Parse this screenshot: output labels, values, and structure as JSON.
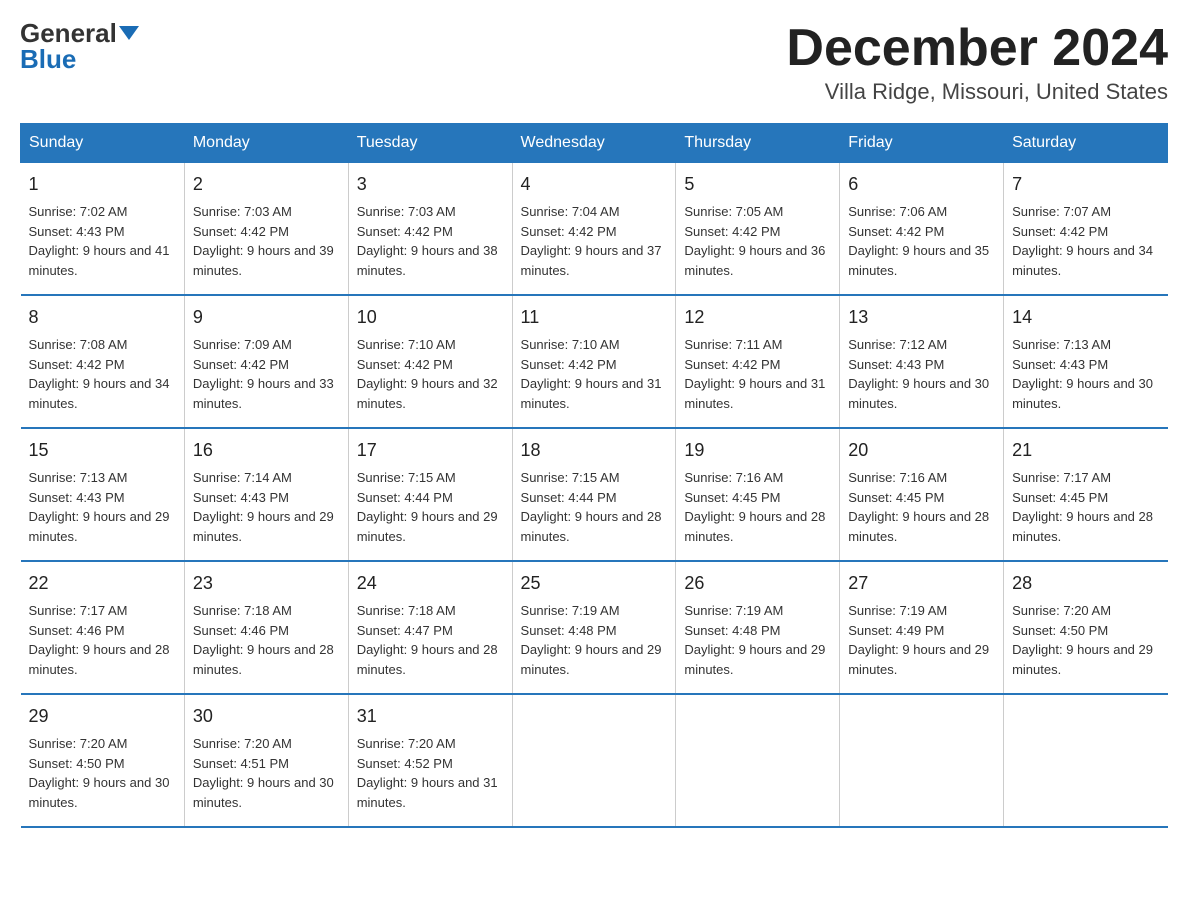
{
  "logo": {
    "line1": "General",
    "arrow": true,
    "line2": "Blue"
  },
  "title": "December 2024",
  "subtitle": "Villa Ridge, Missouri, United States",
  "weekdays": [
    "Sunday",
    "Monday",
    "Tuesday",
    "Wednesday",
    "Thursday",
    "Friday",
    "Saturday"
  ],
  "weeks": [
    [
      {
        "day": "1",
        "sunrise": "Sunrise: 7:02 AM",
        "sunset": "Sunset: 4:43 PM",
        "daylight": "Daylight: 9 hours and 41 minutes."
      },
      {
        "day": "2",
        "sunrise": "Sunrise: 7:03 AM",
        "sunset": "Sunset: 4:42 PM",
        "daylight": "Daylight: 9 hours and 39 minutes."
      },
      {
        "day": "3",
        "sunrise": "Sunrise: 7:03 AM",
        "sunset": "Sunset: 4:42 PM",
        "daylight": "Daylight: 9 hours and 38 minutes."
      },
      {
        "day": "4",
        "sunrise": "Sunrise: 7:04 AM",
        "sunset": "Sunset: 4:42 PM",
        "daylight": "Daylight: 9 hours and 37 minutes."
      },
      {
        "day": "5",
        "sunrise": "Sunrise: 7:05 AM",
        "sunset": "Sunset: 4:42 PM",
        "daylight": "Daylight: 9 hours and 36 minutes."
      },
      {
        "day": "6",
        "sunrise": "Sunrise: 7:06 AM",
        "sunset": "Sunset: 4:42 PM",
        "daylight": "Daylight: 9 hours and 35 minutes."
      },
      {
        "day": "7",
        "sunrise": "Sunrise: 7:07 AM",
        "sunset": "Sunset: 4:42 PM",
        "daylight": "Daylight: 9 hours and 34 minutes."
      }
    ],
    [
      {
        "day": "8",
        "sunrise": "Sunrise: 7:08 AM",
        "sunset": "Sunset: 4:42 PM",
        "daylight": "Daylight: 9 hours and 34 minutes."
      },
      {
        "day": "9",
        "sunrise": "Sunrise: 7:09 AM",
        "sunset": "Sunset: 4:42 PM",
        "daylight": "Daylight: 9 hours and 33 minutes."
      },
      {
        "day": "10",
        "sunrise": "Sunrise: 7:10 AM",
        "sunset": "Sunset: 4:42 PM",
        "daylight": "Daylight: 9 hours and 32 minutes."
      },
      {
        "day": "11",
        "sunrise": "Sunrise: 7:10 AM",
        "sunset": "Sunset: 4:42 PM",
        "daylight": "Daylight: 9 hours and 31 minutes."
      },
      {
        "day": "12",
        "sunrise": "Sunrise: 7:11 AM",
        "sunset": "Sunset: 4:42 PM",
        "daylight": "Daylight: 9 hours and 31 minutes."
      },
      {
        "day": "13",
        "sunrise": "Sunrise: 7:12 AM",
        "sunset": "Sunset: 4:43 PM",
        "daylight": "Daylight: 9 hours and 30 minutes."
      },
      {
        "day": "14",
        "sunrise": "Sunrise: 7:13 AM",
        "sunset": "Sunset: 4:43 PM",
        "daylight": "Daylight: 9 hours and 30 minutes."
      }
    ],
    [
      {
        "day": "15",
        "sunrise": "Sunrise: 7:13 AM",
        "sunset": "Sunset: 4:43 PM",
        "daylight": "Daylight: 9 hours and 29 minutes."
      },
      {
        "day": "16",
        "sunrise": "Sunrise: 7:14 AM",
        "sunset": "Sunset: 4:43 PM",
        "daylight": "Daylight: 9 hours and 29 minutes."
      },
      {
        "day": "17",
        "sunrise": "Sunrise: 7:15 AM",
        "sunset": "Sunset: 4:44 PM",
        "daylight": "Daylight: 9 hours and 29 minutes."
      },
      {
        "day": "18",
        "sunrise": "Sunrise: 7:15 AM",
        "sunset": "Sunset: 4:44 PM",
        "daylight": "Daylight: 9 hours and 28 minutes."
      },
      {
        "day": "19",
        "sunrise": "Sunrise: 7:16 AM",
        "sunset": "Sunset: 4:45 PM",
        "daylight": "Daylight: 9 hours and 28 minutes."
      },
      {
        "day": "20",
        "sunrise": "Sunrise: 7:16 AM",
        "sunset": "Sunset: 4:45 PM",
        "daylight": "Daylight: 9 hours and 28 minutes."
      },
      {
        "day": "21",
        "sunrise": "Sunrise: 7:17 AM",
        "sunset": "Sunset: 4:45 PM",
        "daylight": "Daylight: 9 hours and 28 minutes."
      }
    ],
    [
      {
        "day": "22",
        "sunrise": "Sunrise: 7:17 AM",
        "sunset": "Sunset: 4:46 PM",
        "daylight": "Daylight: 9 hours and 28 minutes."
      },
      {
        "day": "23",
        "sunrise": "Sunrise: 7:18 AM",
        "sunset": "Sunset: 4:46 PM",
        "daylight": "Daylight: 9 hours and 28 minutes."
      },
      {
        "day": "24",
        "sunrise": "Sunrise: 7:18 AM",
        "sunset": "Sunset: 4:47 PM",
        "daylight": "Daylight: 9 hours and 28 minutes."
      },
      {
        "day": "25",
        "sunrise": "Sunrise: 7:19 AM",
        "sunset": "Sunset: 4:48 PM",
        "daylight": "Daylight: 9 hours and 29 minutes."
      },
      {
        "day": "26",
        "sunrise": "Sunrise: 7:19 AM",
        "sunset": "Sunset: 4:48 PM",
        "daylight": "Daylight: 9 hours and 29 minutes."
      },
      {
        "day": "27",
        "sunrise": "Sunrise: 7:19 AM",
        "sunset": "Sunset: 4:49 PM",
        "daylight": "Daylight: 9 hours and 29 minutes."
      },
      {
        "day": "28",
        "sunrise": "Sunrise: 7:20 AM",
        "sunset": "Sunset: 4:50 PM",
        "daylight": "Daylight: 9 hours and 29 minutes."
      }
    ],
    [
      {
        "day": "29",
        "sunrise": "Sunrise: 7:20 AM",
        "sunset": "Sunset: 4:50 PM",
        "daylight": "Daylight: 9 hours and 30 minutes."
      },
      {
        "day": "30",
        "sunrise": "Sunrise: 7:20 AM",
        "sunset": "Sunset: 4:51 PM",
        "daylight": "Daylight: 9 hours and 30 minutes."
      },
      {
        "day": "31",
        "sunrise": "Sunrise: 7:20 AM",
        "sunset": "Sunset: 4:52 PM",
        "daylight": "Daylight: 9 hours and 31 minutes."
      },
      {
        "day": "",
        "sunrise": "",
        "sunset": "",
        "daylight": ""
      },
      {
        "day": "",
        "sunrise": "",
        "sunset": "",
        "daylight": ""
      },
      {
        "day": "",
        "sunrise": "",
        "sunset": "",
        "daylight": ""
      },
      {
        "day": "",
        "sunrise": "",
        "sunset": "",
        "daylight": ""
      }
    ]
  ]
}
